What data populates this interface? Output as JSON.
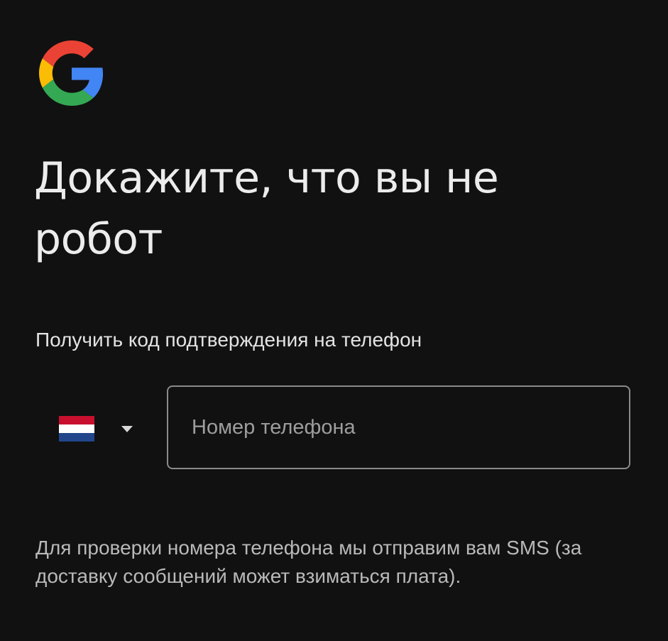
{
  "logo": {
    "icon": "google-g-icon",
    "colors": {
      "red": "#ea4335",
      "yellow": "#fbbc05",
      "green": "#34a853",
      "blue": "#4285f4"
    }
  },
  "title": "Докажите, что вы не робот",
  "subtitle": "Получить код подтверждения на телефон",
  "country_selector": {
    "flag": "netherlands-flag-icon",
    "dropdown_icon": "caret-down-icon"
  },
  "phone_input": {
    "placeholder": "Номер телефона",
    "value": ""
  },
  "footnote": "Для проверки номера телефона мы отправим вам SMS (за доставку сообщений может взиматься плата).",
  "colors": {
    "background": "#111111",
    "text": "#e8eaed",
    "muted_text": "#b9b9b9",
    "field_border": "#8a8a8a"
  }
}
